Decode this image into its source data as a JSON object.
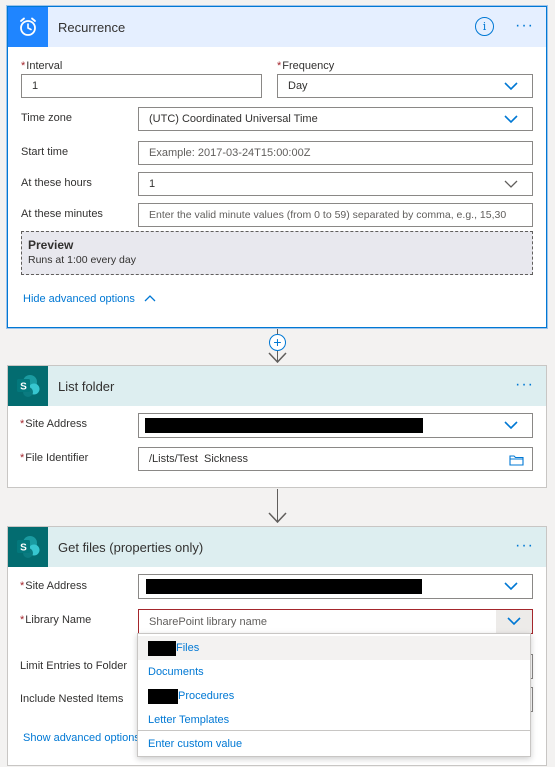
{
  "recurrence": {
    "title": "Recurrence",
    "more": "···",
    "info": "i",
    "interval": {
      "label": "Interval",
      "value": "1"
    },
    "frequency": {
      "label": "Frequency",
      "value": "Day"
    },
    "timezone": {
      "label": "Time zone",
      "value": "(UTC) Coordinated Universal Time"
    },
    "start_time": {
      "label": "Start time",
      "placeholder": "Example: 2017-03-24T15:00:00Z"
    },
    "hours": {
      "label": "At these hours",
      "value": "1"
    },
    "minutes": {
      "label": "At these minutes",
      "placeholder": "Enter the valid minute values (from 0 to 59) separated by comma, e.g., 15,30"
    },
    "preview": {
      "title": "Preview",
      "body": "Runs at 1:00 every day"
    },
    "hide_advanced": "Hide advanced options"
  },
  "list_folder": {
    "title": "List folder",
    "more": "···",
    "site_address": {
      "label": "Site Address"
    },
    "file_identifier": {
      "label": "File Identifier",
      "value": "/Lists/Test  Sickness"
    }
  },
  "get_files": {
    "title": "Get files (properties only)",
    "more": "···",
    "site_address": {
      "label": "Site Address"
    },
    "library_name": {
      "label": "Library Name",
      "placeholder": "SharePoint library name"
    },
    "limit_entries": {
      "label": "Limit Entries to Folder"
    },
    "include_nested": {
      "label": "Include Nested Items"
    },
    "show_advanced": "Show advanced options"
  },
  "dropdown": {
    "items": [
      "Files",
      "Documents",
      "Procedures",
      "Letter Templates"
    ],
    "custom": "Enter custom value"
  },
  "colors": {
    "accent": "#0078d4",
    "recurrence_icon": "#1f85ff",
    "sharepoint_icon": "#036c70",
    "required": "#a4262c"
  }
}
